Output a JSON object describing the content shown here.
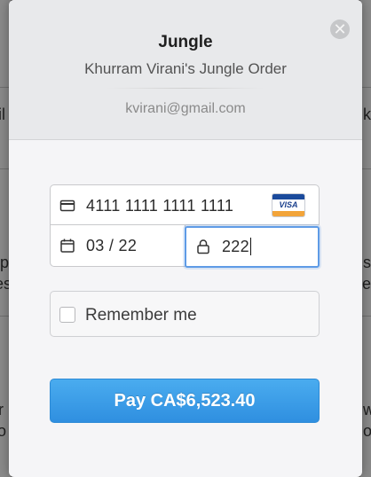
{
  "background": {
    "left_fragments": [
      "il",
      "p",
      "es",
      "r",
      "o"
    ],
    "right_fragments": [
      "k",
      "st",
      "e",
      "w",
      "o"
    ]
  },
  "header": {
    "close_icon": "close-icon",
    "title": "Jungle",
    "subtitle": "Khurram Virani's Jungle Order",
    "email": "kvirani@gmail.com"
  },
  "form": {
    "card_number": "4111 1111 1111 1111",
    "card_brand": "VISA",
    "expiry": "03 / 22",
    "cvc": "222",
    "remember_label": "Remember me",
    "remember_checked": false
  },
  "pay_button": {
    "label": "Pay CA$6,523.40",
    "color": "#3a9be6"
  }
}
